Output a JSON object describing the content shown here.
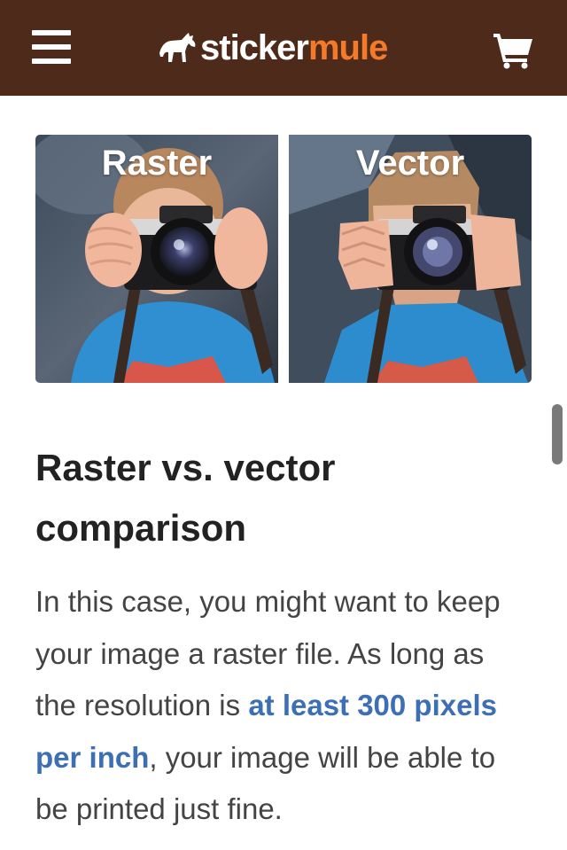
{
  "header": {
    "logo": {
      "part1": "sticker",
      "part2": "mule"
    },
    "menu_icon": "hamburger-icon",
    "cart_icon": "cart-icon",
    "colors": {
      "background": "#4e2a1a",
      "logo_accent": "#f47a2a"
    }
  },
  "comparison": {
    "left_label": "Raster",
    "right_label": "Vector"
  },
  "article": {
    "heading": "Raster vs. vector comparison",
    "paragraph": {
      "before": "In this case, you might want to keep your image a raster file. As long as the resolution is ",
      "link": "at least 300 pixels per inch",
      "after": ", your image will be able to be printed just fine."
    },
    "colors": {
      "heading": "#222222",
      "text": "#444444",
      "link": "#3d6fb4"
    }
  }
}
